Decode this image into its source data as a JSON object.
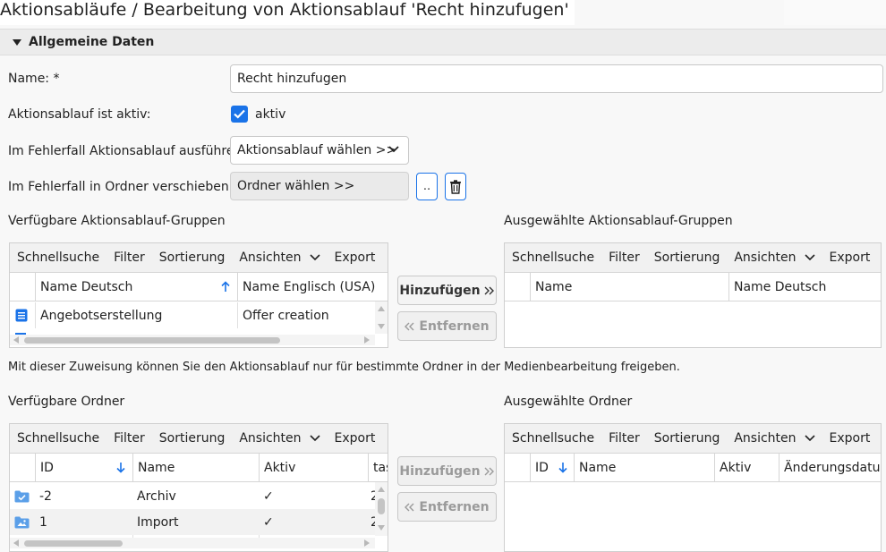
{
  "page": {
    "title": "Aktionsabläufe / Bearbeitung von Aktionsablauf 'Recht hinzufugen'",
    "section_title": "Allgemeine Daten"
  },
  "form": {
    "name_label": "Name: *",
    "name_value": "Recht hinzufugen",
    "active_label": "Aktionsablauf ist aktiv:",
    "active_checked": true,
    "active_text": "aktiv",
    "error_flow_label": "Im Fehlerfall Aktionsablauf ausführen:",
    "error_flow_value": "Aktionsablauf wählen >>",
    "error_folder_label": "Im Fehlerfall in Ordner verschieben:",
    "error_folder_value": "Ordner wählen >>",
    "browse_button": ".."
  },
  "toolbar": {
    "quicksearch": "Schnellsuche",
    "filter": "Filter",
    "sort": "Sortierung",
    "views": "Ansichten",
    "export": "Export"
  },
  "groups": {
    "available_label": "Verfügbare Aktionsablauf-Gruppen",
    "selected_label": "Ausgewählte Aktionsablauf-Gruppen",
    "available_columns": [
      "Name Deutsch",
      "Name Englisch (USA)"
    ],
    "available_rows": [
      {
        "name_de": "Angebotserstellung",
        "name_en": "Offer creation"
      }
    ],
    "selected_columns": [
      "Name",
      "Name Deutsch"
    ],
    "add_button": "Hinzufügen",
    "remove_button": "Entfernen"
  },
  "info_text": "Mit dieser Zuweisung können Sie den Aktionsablauf nur für bestimmte Ordner in der Medienbearbeitung freigeben.",
  "folders": {
    "available_label": "Verfügbare Ordner",
    "selected_label": "Ausgewählte Ordner",
    "available_columns": [
      "ID",
      "Name",
      "Aktiv",
      "tas"
    ],
    "available_rows": [
      {
        "id": "-2",
        "name": "Archiv",
        "active": "✓",
        "extra": "2"
      },
      {
        "id": "1",
        "name": "Import",
        "active": "✓",
        "extra": "2"
      }
    ],
    "selected_columns": [
      "ID",
      "Name",
      "Aktiv",
      "Änderungsdatum"
    ],
    "add_button": "Hinzufügen",
    "remove_button": "Entfernen"
  }
}
